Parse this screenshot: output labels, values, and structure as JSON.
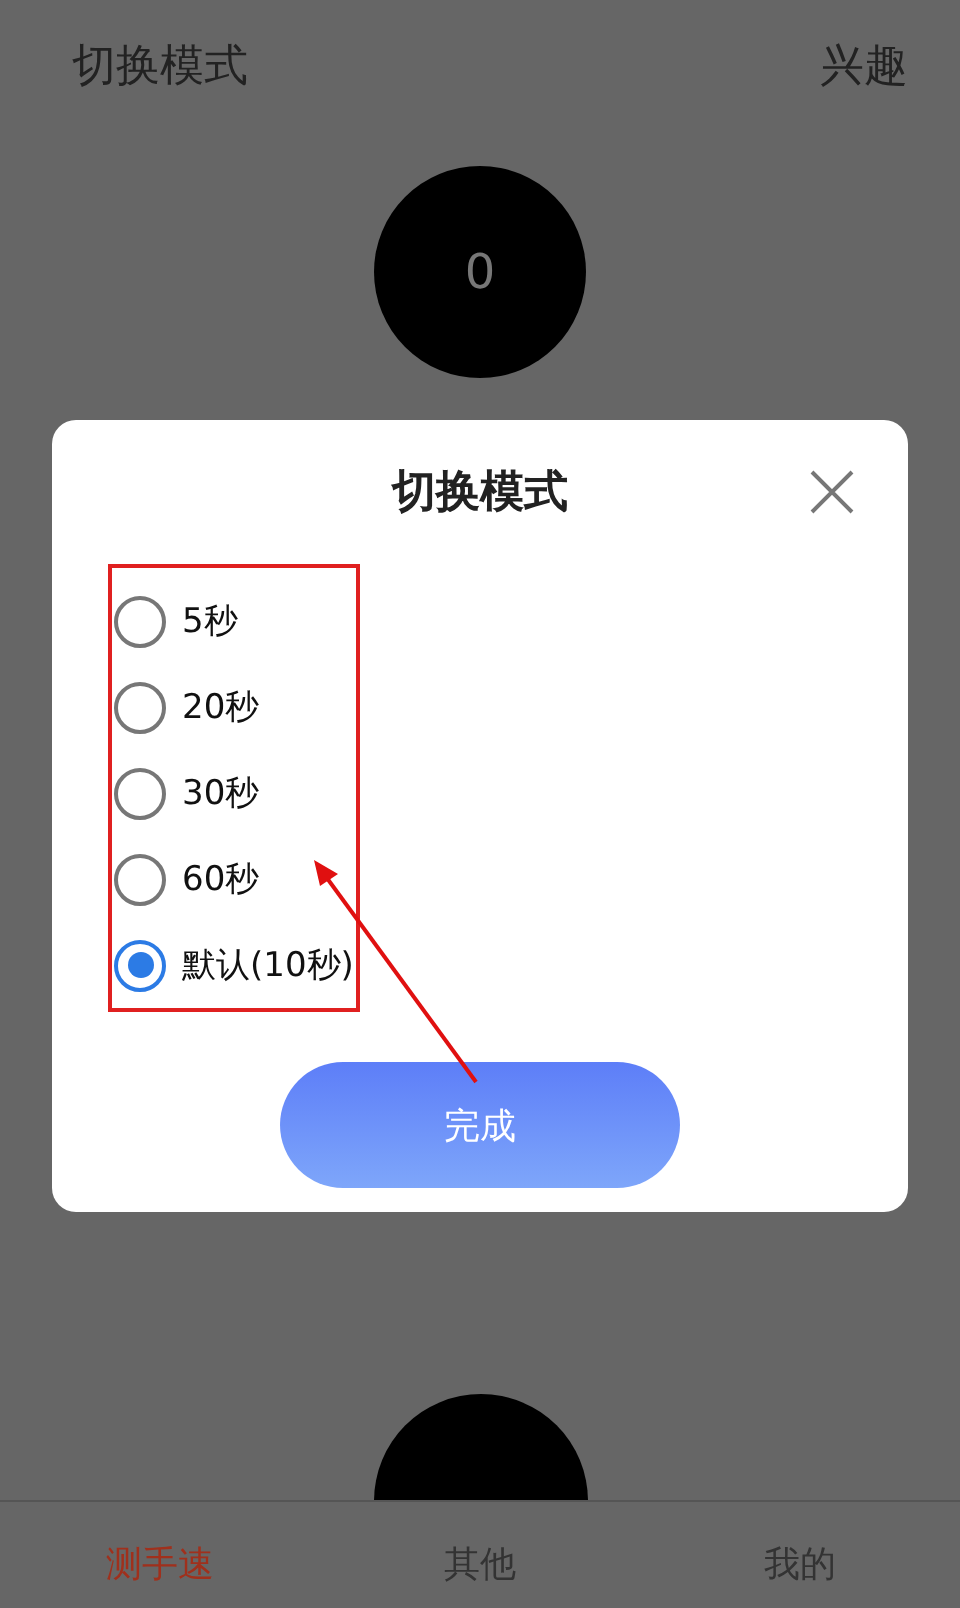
{
  "header": {
    "title": "切换模式",
    "action": "兴趣"
  },
  "counter": "0",
  "dialog": {
    "title": "切换模式",
    "options": [
      {
        "label": "5秒",
        "selected": false
      },
      {
        "label": "20秒",
        "selected": false
      },
      {
        "label": "30秒",
        "selected": false
      },
      {
        "label": "60秒",
        "selected": false
      },
      {
        "label": "默认(10秒)",
        "selected": true
      }
    ],
    "done_button": "完成"
  },
  "tabs": [
    {
      "label": "测手速",
      "selected": true
    },
    {
      "label": "其他",
      "selected": false
    },
    {
      "label": "我的",
      "selected": false
    }
  ]
}
